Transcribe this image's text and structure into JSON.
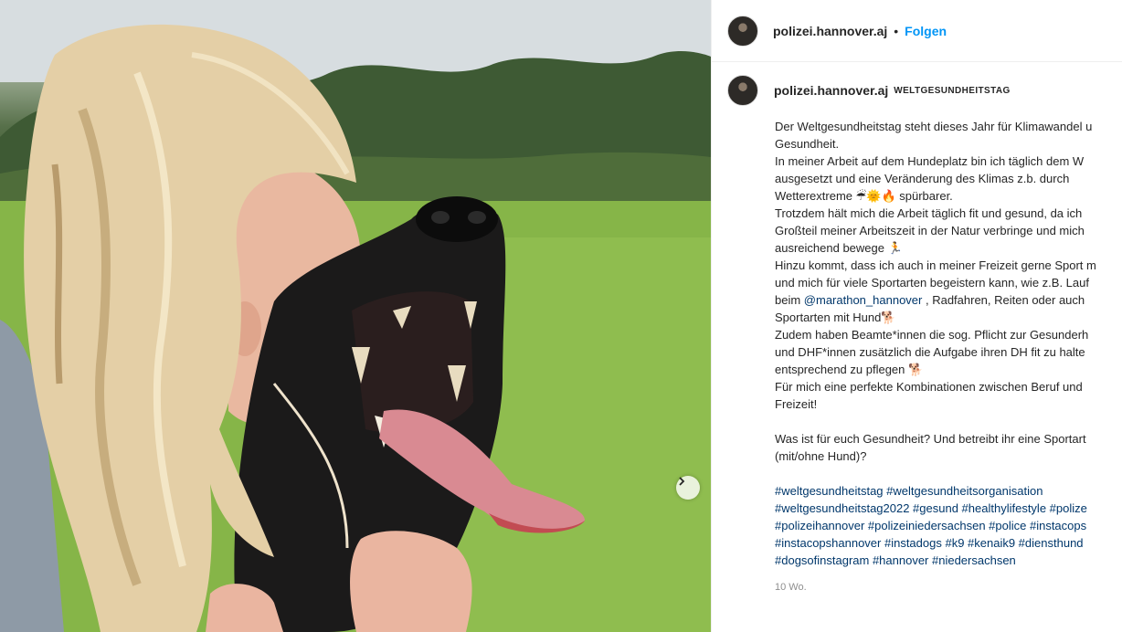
{
  "post": {
    "image_alt": "Woman with blonde ponytail kissing a black police dog in a meadow",
    "next_button_icon": "chevron-right-icon"
  },
  "header": {
    "username": "polizei.hannover.aj",
    "separator": "•",
    "follow_label": "Folgen"
  },
  "caption": {
    "username": "polizei.hannover.aj",
    "tag": "Weltgesundheitstag",
    "lines": [
      "Der Weltgesundheitstag steht dieses Jahr für Klimawandel u",
      "Gesundheit.",
      "In meiner Arbeit auf dem Hundeplatz bin ich täglich dem W",
      "ausgesetzt und eine Veränderung des Klimas z.b. durch",
      "Wetterextreme ☔🌞🔥 spürbarer.",
      "Trotzdem hält mich die Arbeit täglich fit und gesund, da ich",
      "Großteil meiner Arbeitszeit in der Natur verbringe und mich",
      "ausreichend bewege 🏃",
      "Hinzu kommt, dass ich auch in meiner Freizeit gerne Sport m",
      "und mich für viele Sportarten begeistern kann, wie z.B. Lauf",
      "beim @marathon_hannover , Radfahren, Reiten oder auch",
      "Sportarten mit Hund🐕",
      "Zudem haben Beamte*innen die sog. Pflicht zur Gesunderh",
      "und DHF*innen zusätzlich die Aufgabe ihren DH fit zu halte",
      "entsprechend zu pflegen 🐕",
      "Für mich eine perfekte Kombinationen zwischen Beruf und",
      "Freizeit!"
    ],
    "question_lines": [
      "Was ist für euch Gesundheit? Und betreibt ihr eine Sportart",
      "(mit/ohne Hund)?"
    ],
    "hashtag_lines": [
      "#weltgesundheitstag #weltgesundheitsorganisation",
      "#weltgesundheitstag2022 #gesund #healthylifestyle #polize",
      "#polizeihannover #polizeiniedersachsen #police #instacops",
      "#instacopshannover #instadogs #k9 #kenaik9 #diensthund",
      "#dogsofinstagram #hannover #niedersachsen"
    ],
    "timestamp": "10 Wo."
  }
}
